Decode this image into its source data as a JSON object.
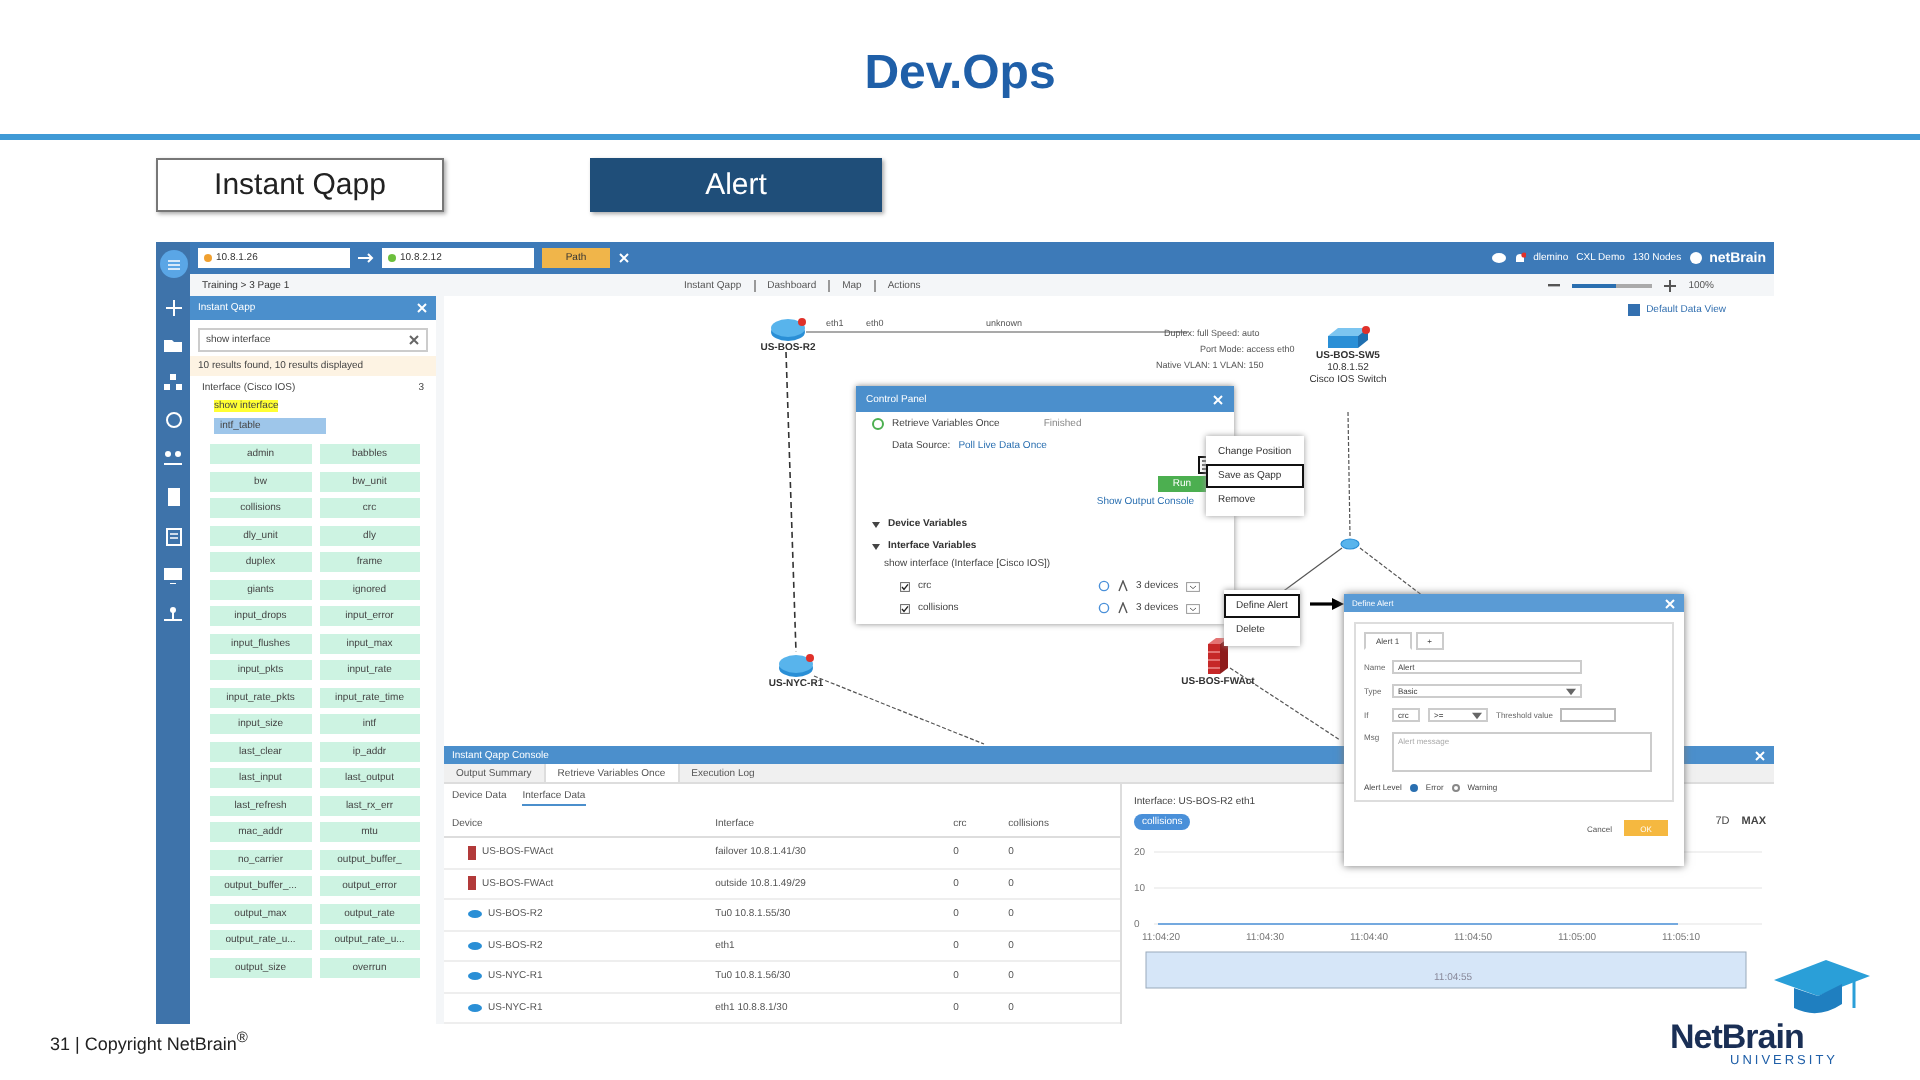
{
  "title": "Dev.Ops",
  "slide_tabs": [
    {
      "label": "Instant Qapp",
      "selected": false
    },
    {
      "label": "Alert",
      "selected": true
    }
  ],
  "app": {
    "header": {
      "source": "10.8.1.26",
      "destination": "10.8.2.12",
      "path_button": "Path",
      "user": "dlemino",
      "domain": "CXL Demo",
      "nodes": "130 Nodes",
      "logo": "netBrain"
    },
    "breadcrumb": "Training > 3 Page 1",
    "qapp_panel": {
      "title": "Instant Qapp",
      "search": "show interface",
      "results": "10 results found, 10 results displayed",
      "device_type": "Interface (Cisco IOS)",
      "count": "3",
      "command": "show interface",
      "table": "intf_table",
      "variables": [
        "admin",
        "babbles",
        "bw",
        "bw_unit",
        "collisions",
        "crc",
        "dly_unit",
        "dly",
        "duplex",
        "frame",
        "giants",
        "ignored",
        "input_drops",
        "input_error",
        "input_flushes",
        "input_max",
        "input_pkts",
        "input_rate",
        "input_rate_pkts",
        "input_rate_time",
        "input_size",
        "intf",
        "last_clear",
        "ip_addr",
        "last_input",
        "last_output",
        "last_refresh",
        "last_rx_err",
        "mac_addr",
        "mtu",
        "no_carrier",
        "output_buffer_",
        "output_buffer_...",
        "output_error",
        "output_max",
        "output_rate",
        "output_rate_u...",
        "output_rate_u...",
        "output_size",
        "overrun"
      ]
    },
    "toolbar": {
      "items": [
        "Instant Qapp",
        "Dashboard",
        "Map",
        "Actions"
      ],
      "zoom": "100%",
      "level": 0.55
    },
    "map": {
      "data_view": "Default Data View",
      "nodes": [
        {
          "kind": "router",
          "name": "US-BOS-R2"
        },
        {
          "kind": "router",
          "name": "US-NYC-R1"
        },
        {
          "kind": "switch",
          "name": "US-BOS-SW5",
          "details": [
            "10.8.1.52",
            "Cisco IOS Switch"
          ]
        },
        {
          "kind": "firewall",
          "name": "US-BOS-FWAct"
        },
        {
          "kind": "hub"
        }
      ],
      "link_labels": [
        "eth1",
        "eth0",
        "unknown",
        "Duplex: full  Speed: auto",
        "Port Mode: access  eth0",
        "Native VLAN: 1  VLAN: 150"
      ]
    },
    "control_panel": {
      "title": "Control Panel",
      "action": "Retrieve Variables Once",
      "status": "Finished",
      "source_label": "Data Source:",
      "source_link": "Poll Live Data Once",
      "menu_highlighted": true,
      "run_button": "Run",
      "console_link": "Show Output Console",
      "sections": [
        "Device Variables",
        "Interface Variables"
      ],
      "command": "show interface (Interface [Cisco IOS])",
      "variables": [
        {
          "name": "crc",
          "checked": true,
          "devices": "3 devices"
        },
        {
          "name": "collisions",
          "checked": true,
          "devices": "3 devices"
        }
      ]
    },
    "panel_menu": [
      {
        "label": "Change Position",
        "highlighted": false
      },
      {
        "label": "Save as Qapp",
        "highlighted": true
      },
      {
        "label": "Remove",
        "highlighted": false
      }
    ],
    "variable_menu": [
      {
        "label": "Define Alert",
        "highlighted": true
      },
      {
        "label": "Delete",
        "highlighted": false
      }
    ],
    "alert_dialog": {
      "title": "Define Alert",
      "tab": "Alert 1",
      "add_tab": "+",
      "name_label": "Name",
      "name": "Alert",
      "type_label": "Type",
      "type": "Basic",
      "if_label": "If",
      "variable": "crc",
      "operator": ">=",
      "threshold_placeholder": "Threshold value",
      "msg_label": "Msg",
      "msg_placeholder": "Alert message",
      "level_label": "Alert Level",
      "levels": [
        {
          "label": "Error",
          "selected": true
        },
        {
          "label": "Warning",
          "selected": false
        }
      ],
      "cancel": "Cancel",
      "ok": "OK"
    },
    "console": {
      "title": "Instant Qapp Console",
      "tabs": [
        {
          "label": "Output Summary",
          "selected": false
        },
        {
          "label": "Retrieve Variables Once",
          "selected": true
        },
        {
          "label": "Execution Log",
          "selected": false
        }
      ],
      "subtabs": [
        {
          "label": "Device Data",
          "selected": false
        },
        {
          "label": "Interface Data",
          "selected": true
        }
      ],
      "columns": [
        "Device",
        "Interface",
        "crc",
        "collisions"
      ],
      "rows": [
        {
          "kind": "firewall",
          "cells": [
            "US-BOS-FWAct",
            "failover 10.8.1.41/30",
            "0",
            "0"
          ]
        },
        {
          "kind": "firewall",
          "cells": [
            "US-BOS-FWAct",
            "outside 10.8.1.49/29",
            "0",
            "0"
          ]
        },
        {
          "kind": "router",
          "cells": [
            "US-BOS-R2",
            "Tu0 10.8.1.55/30",
            "0",
            "0"
          ]
        },
        {
          "kind": "router",
          "cells": [
            "US-BOS-R2",
            "eth1",
            "0",
            "0"
          ]
        },
        {
          "kind": "router",
          "cells": [
            "US-NYC-R1",
            "Tu0 10.8.1.56/30",
            "0",
            "0"
          ]
        },
        {
          "kind": "router",
          "cells": [
            "US-NYC-R1",
            "eth1 10.8.8.1/30",
            "0",
            "0"
          ]
        }
      ]
    },
    "chart": {
      "ranges": [
        "7D",
        "MAX"
      ],
      "navigator_label": "11:04:55",
      "chart_data": {
        "type": "line",
        "title": "Interface: US-BOS-R2 eth1",
        "categories": [
          "11:04:20",
          "11:04:30",
          "11:04:40",
          "11:04:50",
          "11:05:00",
          "11:05:10"
        ],
        "series": [
          {
            "name": "collisions",
            "color": "#4a90d9",
            "values": [
              0,
              0,
              0,
              0,
              0,
              0
            ]
          }
        ],
        "ylim": [
          0,
          20
        ],
        "yticks": [
          0,
          10,
          20
        ]
      }
    }
  },
  "footer": "31 | Copyright NetBrain$^{®}$",
  "logo": {
    "name": "NetBrain",
    "tagline": "UNIVERSITY"
  }
}
